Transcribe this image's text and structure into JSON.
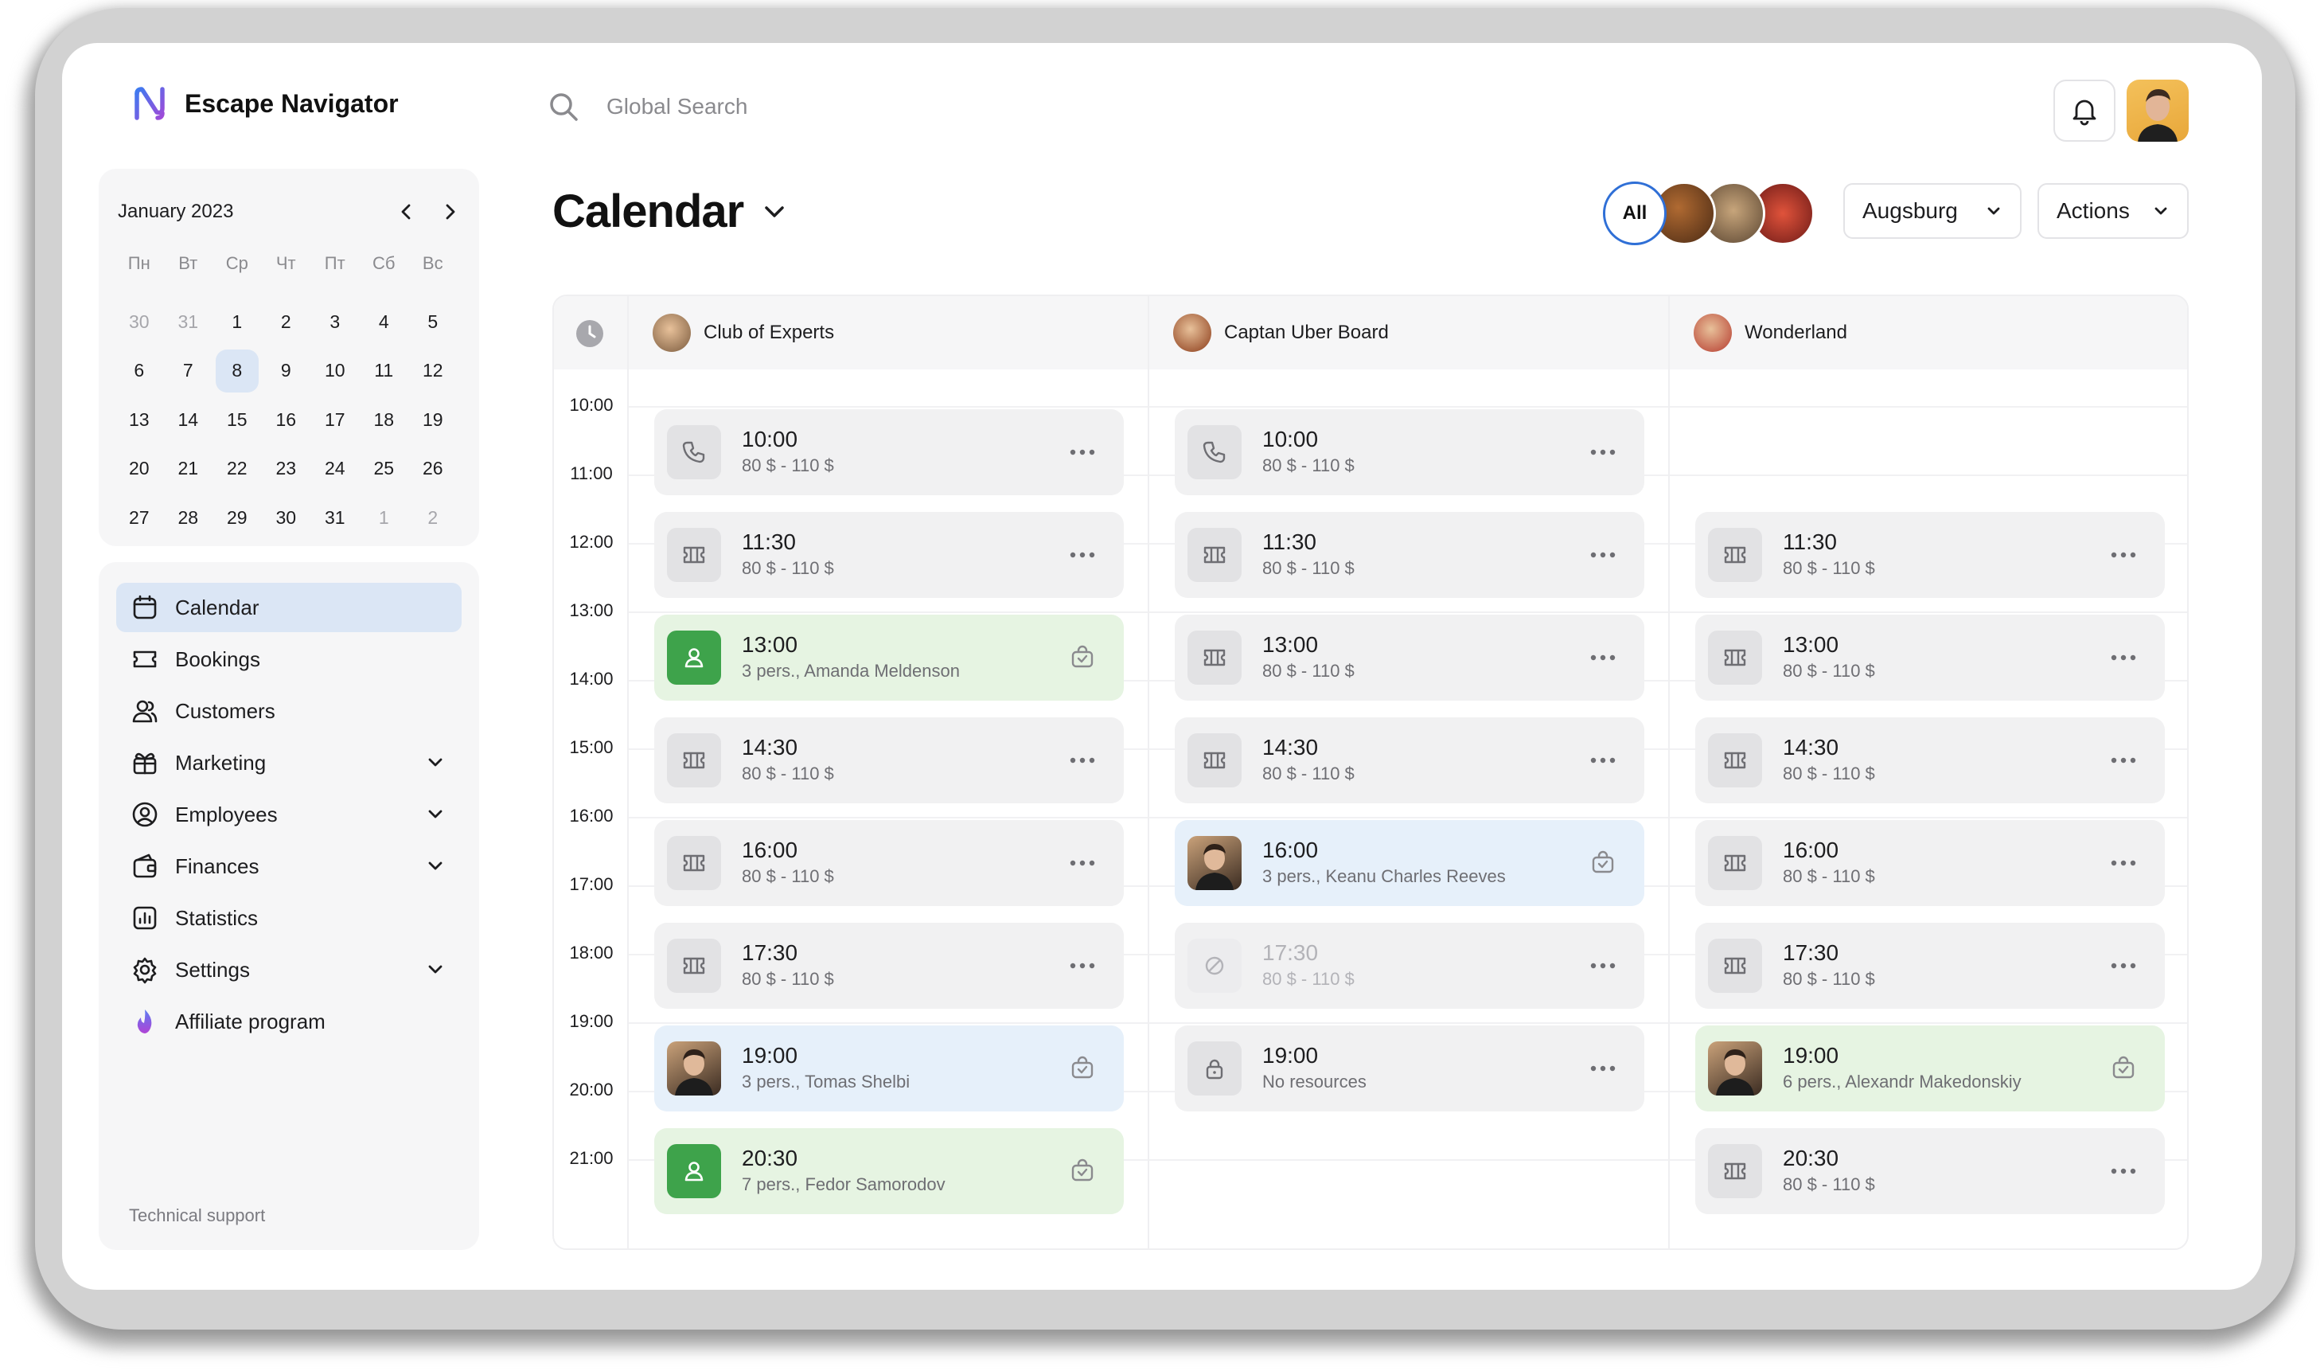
{
  "brand": {
    "name": "Escape Navigator"
  },
  "search": {
    "placeholder": "Global Search"
  },
  "mini_calendar": {
    "month": "January 2023",
    "weekdays": [
      "Пн",
      "Вт",
      "Ср",
      "Чт",
      "Пт",
      "Сб",
      "Вс"
    ],
    "weeks": [
      [
        {
          "d": "30",
          "m": true
        },
        {
          "d": "31",
          "m": true
        },
        {
          "d": "1"
        },
        {
          "d": "2"
        },
        {
          "d": "3"
        },
        {
          "d": "4"
        },
        {
          "d": "5"
        }
      ],
      [
        {
          "d": "6"
        },
        {
          "d": "7"
        },
        {
          "d": "8",
          "sel": true
        },
        {
          "d": "9"
        },
        {
          "d": "10"
        },
        {
          "d": "11"
        },
        {
          "d": "12"
        }
      ],
      [
        {
          "d": "13"
        },
        {
          "d": "14"
        },
        {
          "d": "15"
        },
        {
          "d": "16"
        },
        {
          "d": "17"
        },
        {
          "d": "18"
        },
        {
          "d": "19"
        }
      ],
      [
        {
          "d": "20"
        },
        {
          "d": "21"
        },
        {
          "d": "22"
        },
        {
          "d": "23"
        },
        {
          "d": "24"
        },
        {
          "d": "25"
        },
        {
          "d": "26"
        }
      ],
      [
        {
          "d": "27"
        },
        {
          "d": "28"
        },
        {
          "d": "29"
        },
        {
          "d": "30"
        },
        {
          "d": "31"
        },
        {
          "d": "1",
          "m": true
        },
        {
          "d": "2",
          "m": true
        }
      ]
    ]
  },
  "nav": {
    "items": [
      {
        "label": "Calendar",
        "icon": "calendar-icon",
        "active": true,
        "expandable": false
      },
      {
        "label": "Bookings",
        "icon": "ticket-icon",
        "active": false,
        "expandable": false
      },
      {
        "label": "Customers",
        "icon": "users-icon",
        "active": false,
        "expandable": false
      },
      {
        "label": "Marketing",
        "icon": "gift-icon",
        "active": false,
        "expandable": true
      },
      {
        "label": "Employees",
        "icon": "user-circle-icon",
        "active": false,
        "expandable": true
      },
      {
        "label": "Finances",
        "icon": "wallet-icon",
        "active": false,
        "expandable": true
      },
      {
        "label": "Statistics",
        "icon": "chart-icon",
        "active": false,
        "expandable": false
      },
      {
        "label": "Settings",
        "icon": "gear-icon",
        "active": false,
        "expandable": true
      },
      {
        "label": "Affiliate program",
        "icon": "flame-icon",
        "active": false,
        "expandable": false
      }
    ],
    "support": "Technical support"
  },
  "page": {
    "title": "Calendar"
  },
  "filters": {
    "all_label": "All",
    "location": "Augsburg",
    "actions": "Actions"
  },
  "schedule": {
    "times": [
      "10:00",
      "11:00",
      "12:00",
      "13:00",
      "14:00",
      "15:00",
      "16:00",
      "17:00",
      "18:00",
      "19:00",
      "20:00",
      "21:00"
    ],
    "resources": [
      {
        "name": "Club of Experts",
        "color": "#7a5a3d",
        "slots": [
          {
            "row": 0,
            "time": "10:00",
            "sub": "80 $ - 110 $",
            "kind": "phone",
            "style": "default"
          },
          {
            "row": 1,
            "time": "11:30",
            "sub": "80 $ - 110 $",
            "kind": "ticket",
            "style": "default"
          },
          {
            "row": 2,
            "time": "13:00",
            "sub": "3 pers., Amanda Meldenson",
            "kind": "person",
            "style": "green"
          },
          {
            "row": 3,
            "time": "14:30",
            "sub": "80 $ - 110 $",
            "kind": "ticket",
            "style": "default"
          },
          {
            "row": 4,
            "time": "16:00",
            "sub": "80 $ - 110 $",
            "kind": "ticket",
            "style": "default"
          },
          {
            "row": 5,
            "time": "17:30",
            "sub": "80 $ - 110 $",
            "kind": "ticket",
            "style": "default"
          },
          {
            "row": 6,
            "time": "19:00",
            "sub": "3 pers., Tomas Shelbi",
            "kind": "photo",
            "style": "blue"
          },
          {
            "row": 7,
            "time": "20:30",
            "sub": "7 pers., Fedor Samorodov",
            "kind": "person",
            "style": "green"
          }
        ]
      },
      {
        "name": "Captan Uber Board",
        "color": "#8a3a18",
        "slots": [
          {
            "row": 0,
            "time": "10:00",
            "sub": "80 $ - 110 $",
            "kind": "phone",
            "style": "default"
          },
          {
            "row": 1,
            "time": "11:30",
            "sub": "80 $ - 110 $",
            "kind": "ticket",
            "style": "default"
          },
          {
            "row": 2,
            "time": "13:00",
            "sub": "80 $ - 110 $",
            "kind": "ticket",
            "style": "default"
          },
          {
            "row": 3,
            "time": "14:30",
            "sub": "80 $ - 110 $",
            "kind": "ticket",
            "style": "default"
          },
          {
            "row": 4,
            "time": "16:00",
            "sub": "3 pers., Keanu Charles Reeves",
            "kind": "photo",
            "style": "blue"
          },
          {
            "row": 5,
            "time": "17:30",
            "sub": "80 $ - 110 $",
            "kind": "blocked",
            "style": "dim"
          },
          {
            "row": 6,
            "time": "19:00",
            "sub": "No resources",
            "kind": "lock",
            "style": "default"
          }
        ]
      },
      {
        "name": "Wonderland",
        "color": "#b53a2e",
        "slots": [
          {
            "row": 1,
            "time": "11:30",
            "sub": "80 $ - 110 $",
            "kind": "ticket",
            "style": "default"
          },
          {
            "row": 2,
            "time": "13:00",
            "sub": "80 $ - 110 $",
            "kind": "ticket",
            "style": "default"
          },
          {
            "row": 3,
            "time": "14:30",
            "sub": "80 $ - 110 $",
            "kind": "ticket",
            "style": "default"
          },
          {
            "row": 4,
            "time": "16:00",
            "sub": "80 $ - 110 $",
            "kind": "ticket",
            "style": "default"
          },
          {
            "row": 5,
            "time": "17:30",
            "sub": "80 $ - 110 $",
            "kind": "ticket",
            "style": "default"
          },
          {
            "row": 6,
            "time": "19:00",
            "sub": "6 pers., Alexandr Makedonskiy",
            "kind": "photo",
            "style": "green"
          },
          {
            "row": 7,
            "time": "20:30",
            "sub": "80 $ - 110 $",
            "kind": "ticket",
            "style": "default"
          }
        ]
      }
    ]
  }
}
